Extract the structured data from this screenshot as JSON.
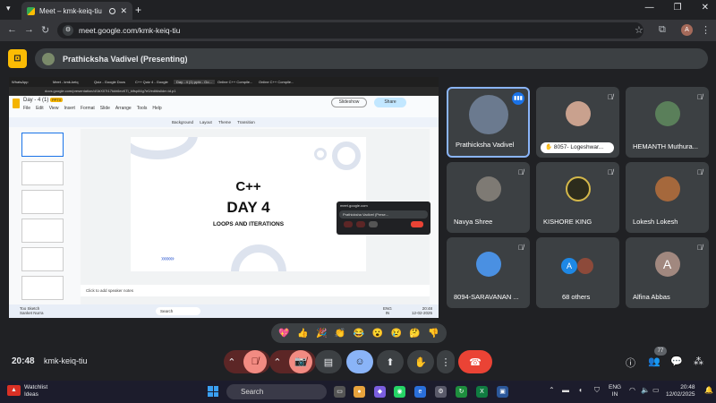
{
  "browser": {
    "tab_title": "Meet – kmk-keiq-tiu",
    "url": "meet.google.com/kmk-keiq-tiu",
    "profile_initial": "A"
  },
  "meet": {
    "presenter_label": "Prathicksha Vadivel (Presenting)",
    "time": "20:48",
    "meeting_code": "kmk-keiq-tiu",
    "participant_count": "77",
    "reactions": [
      "💖",
      "👍",
      "🎉",
      "👏",
      "😂",
      "😮",
      "😢",
      "🤔",
      "👎"
    ]
  },
  "participants": [
    {
      "name": "Prathicksha Vadivel"
    },
    {
      "name": "8057- Logeshwar..."
    },
    {
      "name": "HEMANTH Muthura..."
    },
    {
      "name": "Navya Shree"
    },
    {
      "name": "KISHORE KING"
    },
    {
      "name": "Lokesh Lokesh"
    },
    {
      "name": "8094-SARAVANAN ..."
    },
    {
      "name": "68 others"
    },
    {
      "name": "Alfina Abbas",
      "initial": "A"
    }
  ],
  "others_avatar_initial": "A",
  "shared_screen": {
    "tabs": [
      "WhatsApp",
      "Meet - kmk-keiq",
      "Quiz - Google Docs",
      "C++ Quiz 4 - Google",
      "Day - 4 (1) pptx - Go...",
      "Online C++ Compile...",
      "Online C++ Compile..."
    ],
    "address": "docs.google.com/presentation/d/1bX07t17kkh6ecKTi_ktfsp84g7e0/edit#slide=id.p1",
    "doc_title": "Day - 4 (1)",
    "doc_badge": "PPTX",
    "menus": [
      "File",
      "Edit",
      "View",
      "Insert",
      "Format",
      "Slide",
      "Arrange",
      "Tools",
      "Help"
    ],
    "slideshow_label": "Slideshow",
    "share_label": "Share",
    "toolbar": "Background Layout Theme Transition",
    "slide_title1": "C++",
    "slide_title2": "DAY 4",
    "slide_subtitle": "LOOPS AND ITERATIONS",
    "slide_arrows": "»»»»",
    "speaker_notes": "Click to add speaker notes",
    "mini_meet_url": "meet.google.com",
    "mini_meet_label": "Prathicksha Vadivel (Prese...",
    "weather_line1": "Too Sketch",
    "weather_line2": "Sanket Nurra",
    "taskbar_search": "Search",
    "lang1": "ENG",
    "lang2": "IN",
    "clock_time": "20:48",
    "clock_date": "12-02-2025"
  },
  "taskbar": {
    "weather_title": "Watchlist",
    "weather_sub": "Ideas",
    "search_label": "Search",
    "lang_line1": "ENG",
    "lang_line2": "IN",
    "time": "20:48",
    "date": "12/02/2025"
  }
}
